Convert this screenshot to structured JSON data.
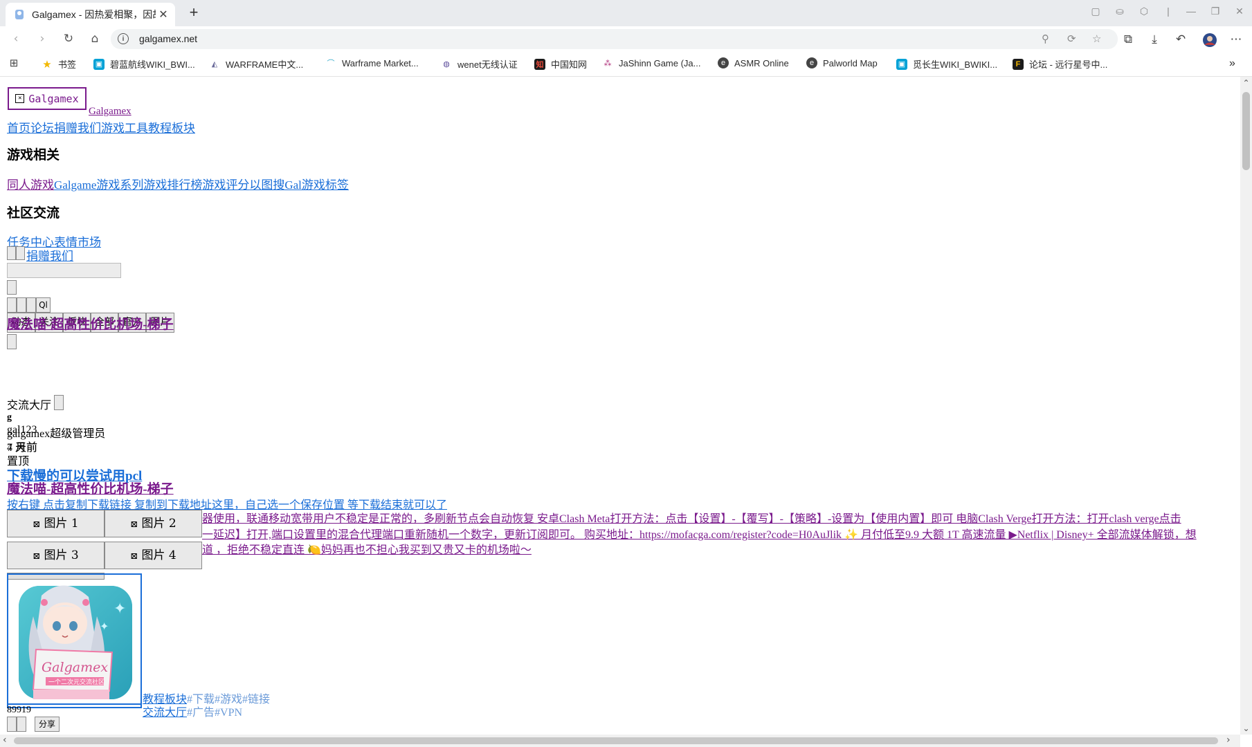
{
  "browser": {
    "tab_title": "Galgamex - 因热爱相聚，因故",
    "url": "galgamex.net",
    "bookmarks": [
      {
        "label": "书签",
        "icon": "star-icon",
        "color": "#f2b800"
      },
      {
        "label": "碧蓝航线WIKI_BWI...",
        "icon": "bilibili-icon",
        "color": "#00a1d6"
      },
      {
        "label": "WARFRAME中文...",
        "icon": "warframe-icon",
        "color": "#6a6a9a"
      },
      {
        "label": "Warframe Market...",
        "icon": "warframe-market-icon",
        "color": "#2aa6c8"
      },
      {
        "label": "wenet无线认证",
        "icon": "wenet-icon",
        "color": "#5a4a9a"
      },
      {
        "label": "中国知网",
        "icon": "cnki-icon",
        "color": "#c0392b"
      },
      {
        "label": "JaShinn Game (Ja...",
        "icon": "jashinn-icon",
        "color": "#b0307a"
      },
      {
        "label": "ASMR Online",
        "icon": "asmr-icon",
        "color": "#444444"
      },
      {
        "label": "Palworld Map",
        "icon": "palworld-icon",
        "color": "#444444"
      },
      {
        "label": "觅长生WIKI_BWIKI...",
        "icon": "bilibili-icon",
        "color": "#00a1d6"
      },
      {
        "label": "论坛 - 远行星号中...",
        "icon": "forum-icon",
        "color": "#e0a000"
      }
    ]
  },
  "site": {
    "logo_alt": "Galgamex",
    "logo_link": "Galgamex",
    "nav": [
      "首页",
      "论坛",
      "捐赠我们",
      "游戏",
      "工具",
      "教程",
      "板块"
    ],
    "section_games": "游戏相关",
    "games_links": [
      "同人游戏",
      "Galgame",
      "游戏系列",
      "游戏排行榜",
      "游戏评分",
      "以图搜",
      "Gal游戏标签"
    ],
    "section_community": "社区交流",
    "community_links": [
      "任务中心",
      "表情市场"
    ],
    "donate_link": "捐赠我们",
    "search_btn": "Ql",
    "filter_tabs": [
      "动态",
      "关注",
      "板块",
      "全部",
      "官方",
      "图片"
    ]
  },
  "post": {
    "ad_title": "魔法喵-超高性价比机场-梯子",
    "board": "交流大厅",
    "overlap_lines": [
      "g",
      "gal123",
      "galgamex",
      "超级管理员",
      "4 天前",
      "7 月前"
    ],
    "pinned": "置顶",
    "subtitle": "下载慢的可以尝试用pcl",
    "title2": "魔法喵-超高性价比机场-梯子",
    "line1": "按右键 点击复制下载链接 复制到下载地址这里，自己选一个保存位置 等下载结束就可以了",
    "line2": "器使用，联通移动宽带用户不稳定是正常的，多刷新节点会自动恢复 安卓Clash Meta打开方法：点击【设置】-【覆写】-【策略】-设置为【使用内置】即可 电脑Clash Verge打开方法：打开clash verge点击",
    "line3": "一延迟】打开,端口设置里的混合代理端口重新随机一个数字，更新订阅即可。 购买地址：https://mofacga.com/register?code=H0AuJlik ✨ 月付低至9.9 大额 1T 高速流量 ▶Netflix | Disney+ 全部流媒体解锁，想",
    "line4": "道 ，拒绝不稳定直连 🍋妈妈再也不担心我买到又贵又卡的机场啦～",
    "image_buttons": [
      "图片 1",
      "图片 2",
      "图片 3",
      "图片 4"
    ],
    "avatar_banner": "Galgamex",
    "avatar_sub": "一个二次元交流社区",
    "tags_row1_board": "教程板块",
    "tags_row1": [
      "#下载",
      "#游戏",
      "#链接"
    ],
    "tags_row2_board": "交流大厅",
    "tags_row2": [
      "#广告",
      "#VPN"
    ],
    "count": "89919",
    "share": "分享"
  }
}
